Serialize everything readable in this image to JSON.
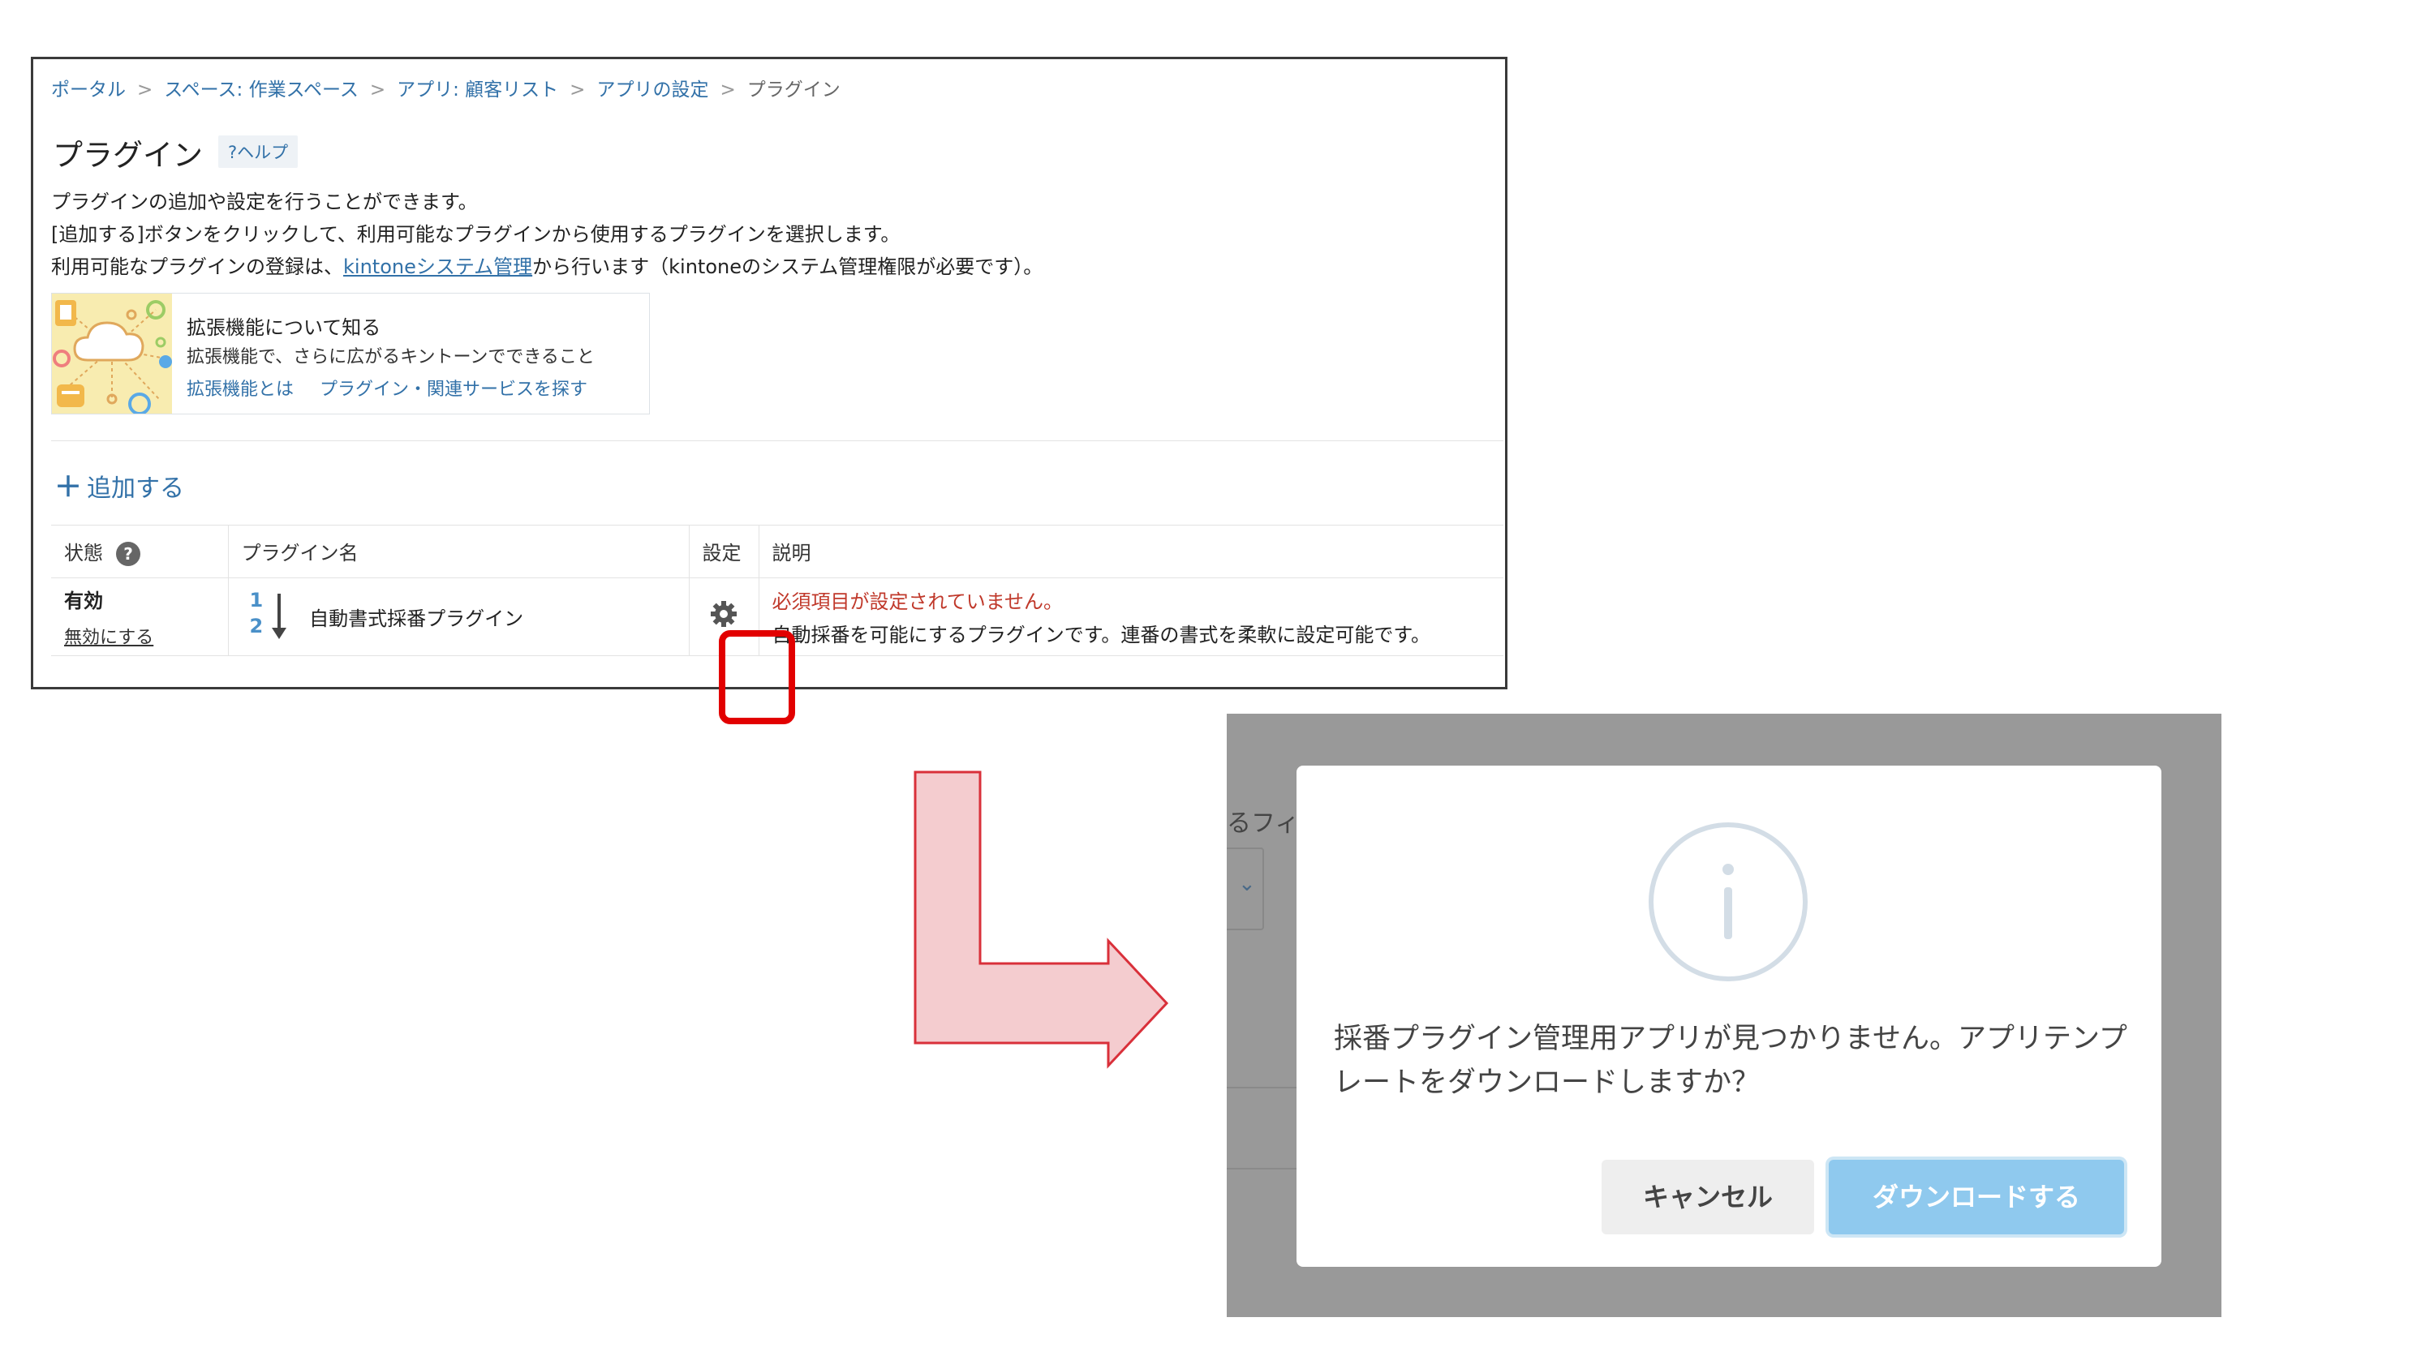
{
  "panel": {
    "breadcrumb": [
      "ポータル",
      "スペース: 作業スペース",
      "アプリ: 顧客リスト",
      "アプリの設定",
      "プラグイン"
    ],
    "breadcrumb_sep": ">",
    "title": "プラグイン",
    "help": "?ヘルプ",
    "desc_line1": "プラグインの追加や設定を行うことができます。",
    "desc_line2": "[追加する]ボタンをクリックして、利用可能なプラグインから使用するプラグインを選択します。",
    "desc_line3_pre": "利用可能なプラグインの登録は、",
    "desc_line3_link": "kintoneシステム管理",
    "desc_line3_post": "から行います（kintoneのシステム管理権限が必要です）。",
    "ext_card": {
      "title": "拡張機能について知る",
      "subtitle": "拡張機能で、さらに広がるキントーンでできること",
      "link1": "拡張機能とは",
      "link2": "プラグイン・関連サービスを探す"
    },
    "add_label": "追加する",
    "table": {
      "headers": {
        "status": "状態",
        "name": "プラグイン名",
        "settings": "設定",
        "description": "説明"
      },
      "rows": [
        {
          "status": "有効",
          "disable": "無効にする",
          "icon_top": "1",
          "icon_bottom": "2",
          "name": "自動書式採番プラグイン",
          "warning": "必須項目が設定されていません。",
          "description": "自動採番を可能にするプラグインです。連番の書式を柔軟に設定可能です。"
        }
      ]
    }
  },
  "dialog": {
    "background_text": "るフィー",
    "message": "採番プラグイン管理用アプリが見つかりません。アプリテンプレートをダウンロードしますか？",
    "cancel": "キャンセル",
    "download": "ダウンロードする",
    "icon": "info-icon"
  },
  "colors": {
    "link": "#3271a8",
    "warning": "#c0392b",
    "highlight": "#e20000",
    "arrow_fill": "#f4cccf",
    "arrow_stroke": "#d9303a",
    "overlay": "#999999",
    "primary_button": "#8fc9ee"
  }
}
